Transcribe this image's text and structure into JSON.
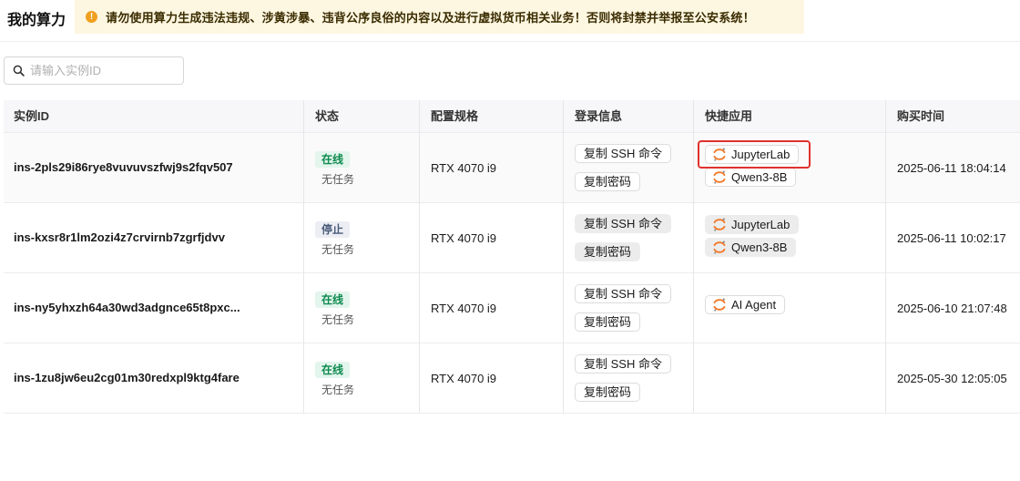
{
  "header": {
    "title": "我的算力",
    "warning": "请勿使用算力生成违法违规、涉黄涉暴、违背公序良俗的内容以及进行虚拟货币相关业务！否则将封禁并举报至公安系统！"
  },
  "search": {
    "placeholder": "请输入实例ID",
    "value": ""
  },
  "table": {
    "columns": [
      "实例ID",
      "状态",
      "配置规格",
      "登录信息",
      "快捷应用",
      "购买时间"
    ],
    "rows": [
      {
        "id": "ins-2pls29i86rye8vuvuvszfwj9s2fqv507",
        "status": "在线",
        "task": "无任务",
        "spec": "RTX 4070 i9",
        "login": [
          "复制 SSH 命令",
          "复制密码"
        ],
        "apps": [
          "JupyterLab",
          "Qwen3-8B"
        ],
        "time": "2025-06-11 18:04:14"
      },
      {
        "id": "ins-kxsr8r1lm2ozi4z7crvirnb7zgrfjdvv",
        "status": "停止",
        "task": "无任务",
        "spec": "RTX 4070 i9",
        "login": [
          "复制 SSH 命令",
          "复制密码"
        ],
        "apps": [
          "JupyterLab",
          "Qwen3-8B"
        ],
        "time": "2025-06-11 10:02:17"
      },
      {
        "id": "ins-ny5yhxzh64a30wd3adgnce65t8pxc...",
        "status": "在线",
        "task": "无任务",
        "spec": "RTX 4070 i9",
        "login": [
          "复制 SSH 命令",
          "复制密码"
        ],
        "apps": [
          "AI Agent"
        ],
        "time": "2025-06-10 21:07:48"
      },
      {
        "id": "ins-1zu8jw6eu2cg01m30redxpl9ktg4fare",
        "status": "在线",
        "task": "无任务",
        "spec": "RTX 4070 i9",
        "login": [
          "复制 SSH 命令",
          "复制密码"
        ],
        "apps": [],
        "time": "2025-05-30 12:05:05"
      }
    ]
  },
  "icons": {
    "warning": "warning-circle-icon",
    "search": "search-icon",
    "app": "jupyter-icon"
  },
  "colors": {
    "online_badge": "#e3f5ec",
    "online_text": "#0e8a4f",
    "stopped_badge": "#eceef3",
    "stopped_text": "#485b7a",
    "warning_bg": "#fdf6e1",
    "highlight": "#e0322d",
    "jupyter_orange": "#f37726"
  }
}
